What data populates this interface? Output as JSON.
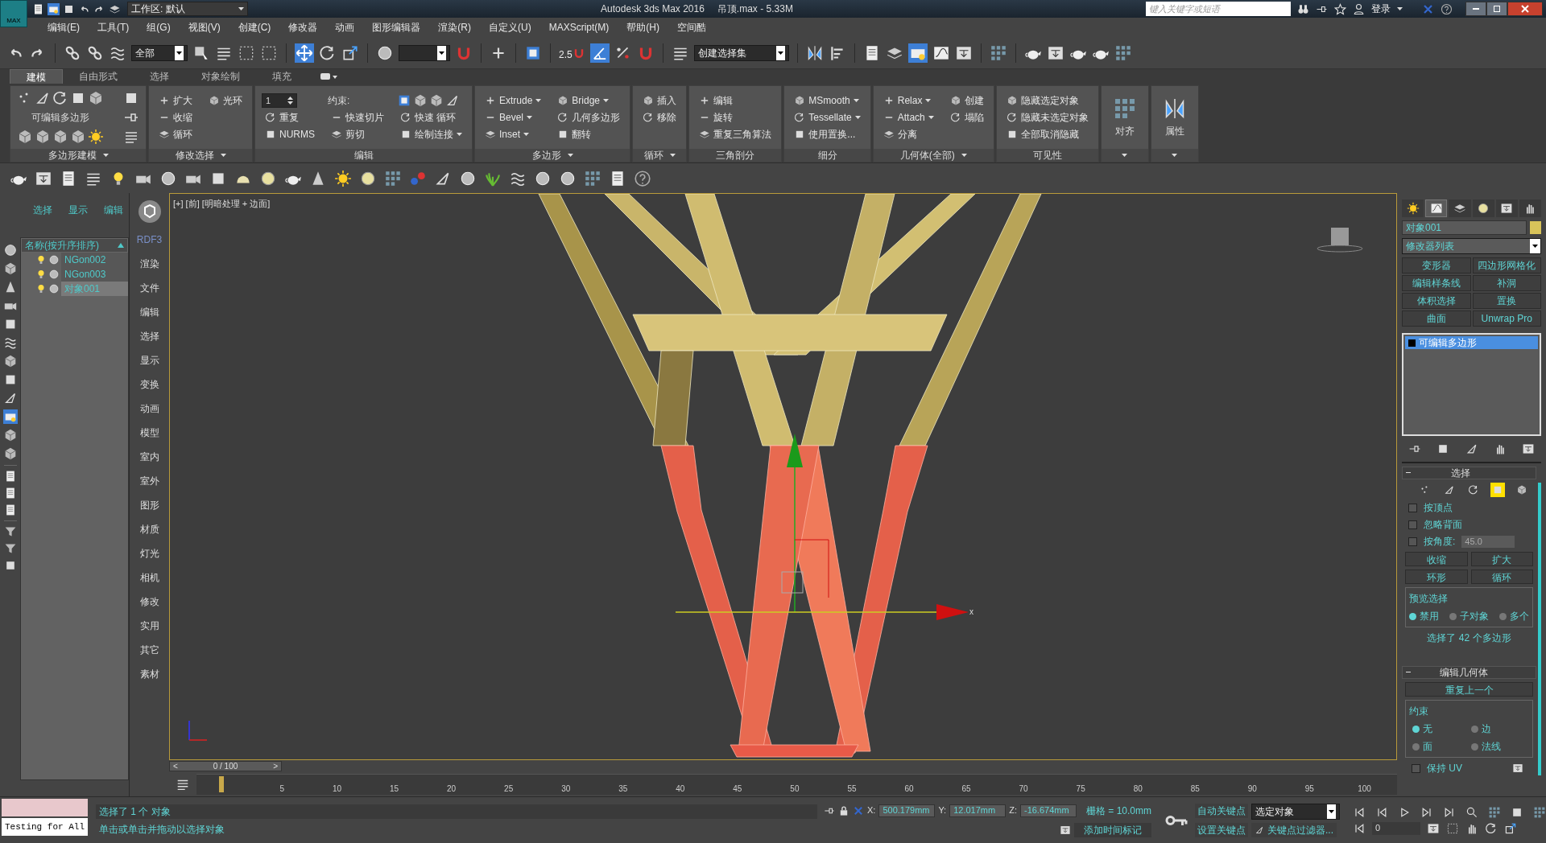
{
  "title_bar": {
    "app_label": "MAX",
    "workspace": "工作区: 默认",
    "title": "Autodesk 3ds Max 2016",
    "file": "吊顶.max - 5.33M",
    "search_placeholder": "键入关键字或短语",
    "login": "登录"
  },
  "menu": [
    "编辑(E)",
    "工具(T)",
    "组(G)",
    "视图(V)",
    "创建(C)",
    "修改器",
    "动画",
    "图形编辑器",
    "渲染(R)",
    "自定义(U)",
    "MAXScript(M)",
    "帮助(H)",
    "空间酷"
  ],
  "main_toolbar": {
    "selection_filter": "全部",
    "snap_label": "2.5",
    "named_selection": "创建选择集"
  },
  "ribbon_tabs": [
    {
      "label": "建模",
      "selected": true
    },
    {
      "label": "自由形式",
      "selected": false
    },
    {
      "label": "选择",
      "selected": false
    },
    {
      "label": "对象绘制",
      "selected": false
    },
    {
      "label": "填充",
      "selected": false
    }
  ],
  "ribbon_panels": [
    {
      "kind": "polygon_modeling",
      "title": "多边形建模",
      "menu": true,
      "items": [
        {
          "kind": "label",
          "label": "可编辑多边形"
        }
      ]
    },
    {
      "kind": "grid",
      "title": "修改选择",
      "menu": true,
      "items": [
        {
          "kind": "button",
          "label": "扩大",
          "dropdown": false
        },
        {
          "kind": "button",
          "label": "收缩",
          "dropdown": false
        },
        {
          "kind": "button",
          "label": "循环",
          "dropdown": false
        },
        {
          "kind": "button",
          "label": "光环",
          "dropdown": false
        }
      ]
    },
    {
      "kind": "grid",
      "title": "编辑",
      "menu": false,
      "items": [
        {
          "kind": "spinner",
          "label": "1"
        },
        {
          "kind": "button",
          "label": "重复",
          "dropdown": false
        },
        {
          "kind": "button",
          "label": "NURMS",
          "dropdown": false
        },
        {
          "kind": "label",
          "label": "约束:"
        },
        {
          "kind": "button",
          "label": "快速切片",
          "dropdown": false
        },
        {
          "kind": "button",
          "label": "剪切",
          "dropdown": false
        },
        {
          "kind": "constraints"
        },
        {
          "kind": "button",
          "label": "快速 循环",
          "dropdown": false
        },
        {
          "kind": "button",
          "label": "绘制连接",
          "dropdown": true
        }
      ]
    },
    {
      "kind": "grid",
      "title": "多边形",
      "menu": true,
      "items": [
        {
          "kind": "button",
          "label": "Extrude",
          "dropdown": true
        },
        {
          "kind": "button",
          "label": "Bevel",
          "dropdown": true
        },
        {
          "kind": "button",
          "label": "Inset",
          "dropdown": true
        },
        {
          "kind": "button",
          "label": "Bridge",
          "dropdown": true
        },
        {
          "kind": "button",
          "label": "几何多边形",
          "dropdown": false
        },
        {
          "kind": "button",
          "label": "翻转",
          "dropdown": false
        }
      ]
    },
    {
      "kind": "grid",
      "title": "循环",
      "menu": true,
      "items": [
        {
          "kind": "button",
          "label": "插入",
          "dropdown": false
        },
        {
          "kind": "button",
          "label": "移除",
          "dropdown": false
        }
      ]
    },
    {
      "kind": "grid",
      "title": "三角剖分",
      "menu": false,
      "items": [
        {
          "kind": "button",
          "label": "编辑",
          "dropdown": false
        },
        {
          "kind": "button",
          "label": "旋转",
          "dropdown": false
        },
        {
          "kind": "button",
          "label": "重复三角算法",
          "dropdown": false
        }
      ]
    },
    {
      "kind": "grid",
      "title": "细分",
      "menu": false,
      "items": [
        {
          "kind": "button",
          "label": "MSmooth",
          "dropdown": true
        },
        {
          "kind": "button",
          "label": "Tessellate",
          "dropdown": true
        },
        {
          "kind": "button",
          "label": "使用置换...",
          "dropdown": false
        }
      ]
    },
    {
      "kind": "grid",
      "title": "几何体(全部)",
      "menu": true,
      "items": [
        {
          "kind": "button",
          "label": "Relax",
          "dropdown": true
        },
        {
          "kind": "button",
          "label": "Attach",
          "dropdown": true
        },
        {
          "kind": "button",
          "label": "分离",
          "dropdown": false
        },
        {
          "kind": "button",
          "label": "创建",
          "dropdown": false
        },
        {
          "kind": "button",
          "label": "塌陷",
          "dropdown": false
        }
      ]
    },
    {
      "kind": "grid",
      "title": "可见性",
      "menu": false,
      "items": [
        {
          "kind": "button",
          "label": "隐藏选定对象",
          "dropdown": false
        },
        {
          "kind": "button",
          "label": "隐藏未选定对象",
          "dropdown": false
        },
        {
          "kind": "button",
          "label": "全部取消隐藏",
          "dropdown": false
        }
      ]
    },
    {
      "kind": "large",
      "title": "对齐",
      "menu": true
    },
    {
      "kind": "large",
      "title": "属性",
      "menu": true
    }
  ],
  "scene_explorer": {
    "tabs": [
      "选择",
      "显示",
      "编辑"
    ],
    "column": "名称(按升序排序)",
    "rows": [
      {
        "name": "NGon002",
        "selected": false
      },
      {
        "name": "NGon003",
        "selected": false
      },
      {
        "name": "对象001",
        "selected": true
      }
    ]
  },
  "side_menu": [
    "RDF3",
    "渲染",
    "文件",
    "编辑",
    "选择",
    "显示",
    "变换",
    "动画",
    "模型",
    "室内",
    "室外",
    "图形",
    "材质",
    "灯光",
    "相机",
    "修改",
    "实用",
    "其它",
    "素材"
  ],
  "viewport": {
    "label": "[+] [前] [明暗处理 + 边面]",
    "axis_label": "x"
  },
  "command_panel": {
    "tabs": [
      {
        "selected": false
      },
      {
        "selected": true
      },
      {
        "selected": false
      },
      {
        "selected": false
      },
      {
        "selected": false
      },
      {
        "selected": false
      }
    ],
    "object_name": "对象001",
    "modifier_list": "修改器列表",
    "modifier_buttons": [
      "变形器",
      "四边形网格化",
      "编辑样条线",
      "补洞",
      "体积选择",
      "置换",
      "曲面",
      "Unwrap Pro"
    ],
    "stack": [
      {
        "label": "可编辑多边形",
        "selected": true
      }
    ],
    "selection": {
      "title": "选择",
      "levels": [
        {
          "selected": false
        },
        {
          "selected": false
        },
        {
          "selected": false
        },
        {
          "selected": true
        },
        {
          "selected": false
        }
      ],
      "checks": [
        {
          "label": "按顶点",
          "checked": false
        },
        {
          "label": "忽略背面",
          "checked": false
        },
        {
          "label": "按角度:",
          "checked": false
        }
      ],
      "angle": "45.0",
      "buttons": [
        "收缩",
        "扩大"
      ],
      "spinners": [
        "环形",
        "循环"
      ],
      "preview_title": "预览选择",
      "preview": [
        {
          "label": "禁用",
          "selected": true
        },
        {
          "label": "子对象",
          "selected": false
        },
        {
          "label": "多个",
          "selected": false
        }
      ],
      "status": "选择了 42 个多边形"
    },
    "edit_geometry": {
      "title": "编辑几何体",
      "repeat": "重复上一个",
      "constraint_title": "约束",
      "constraints": [
        {
          "label": "无",
          "selected": true
        },
        {
          "label": "边",
          "selected": false
        },
        {
          "label": "面",
          "selected": false
        },
        {
          "label": "法线",
          "selected": false
        }
      ],
      "preserve_uv": {
        "label": "保持 UV",
        "checked": false
      }
    }
  },
  "time_slider": {
    "prev": "<",
    "label": "0 / 100",
    "next": ">"
  },
  "track_ticks": [
    "5",
    "10",
    "15",
    "20",
    "25",
    "30",
    "35",
    "40",
    "45",
    "50",
    "55",
    "60",
    "65",
    "70",
    "75",
    "80",
    "85",
    "90",
    "95",
    "100"
  ],
  "status_bar": {
    "listener": "Testing for All",
    "selected": "选择了 1 个 对象",
    "prompt": "单击或单击并拖动以选择对象",
    "x_label": "X:",
    "x": "500.179mm",
    "y_label": "Y:",
    "y": "12.017mm",
    "z_label": "Z:",
    "z": "-16.674mm",
    "grid": "栅格 = 10.0mm",
    "add_tag": "添加时间标记",
    "auto_key": "自动关键点",
    "key_mode": "选定对象",
    "set_key": "设置关键点",
    "key_filters": "关键点过滤器...",
    "frame": "0"
  }
}
